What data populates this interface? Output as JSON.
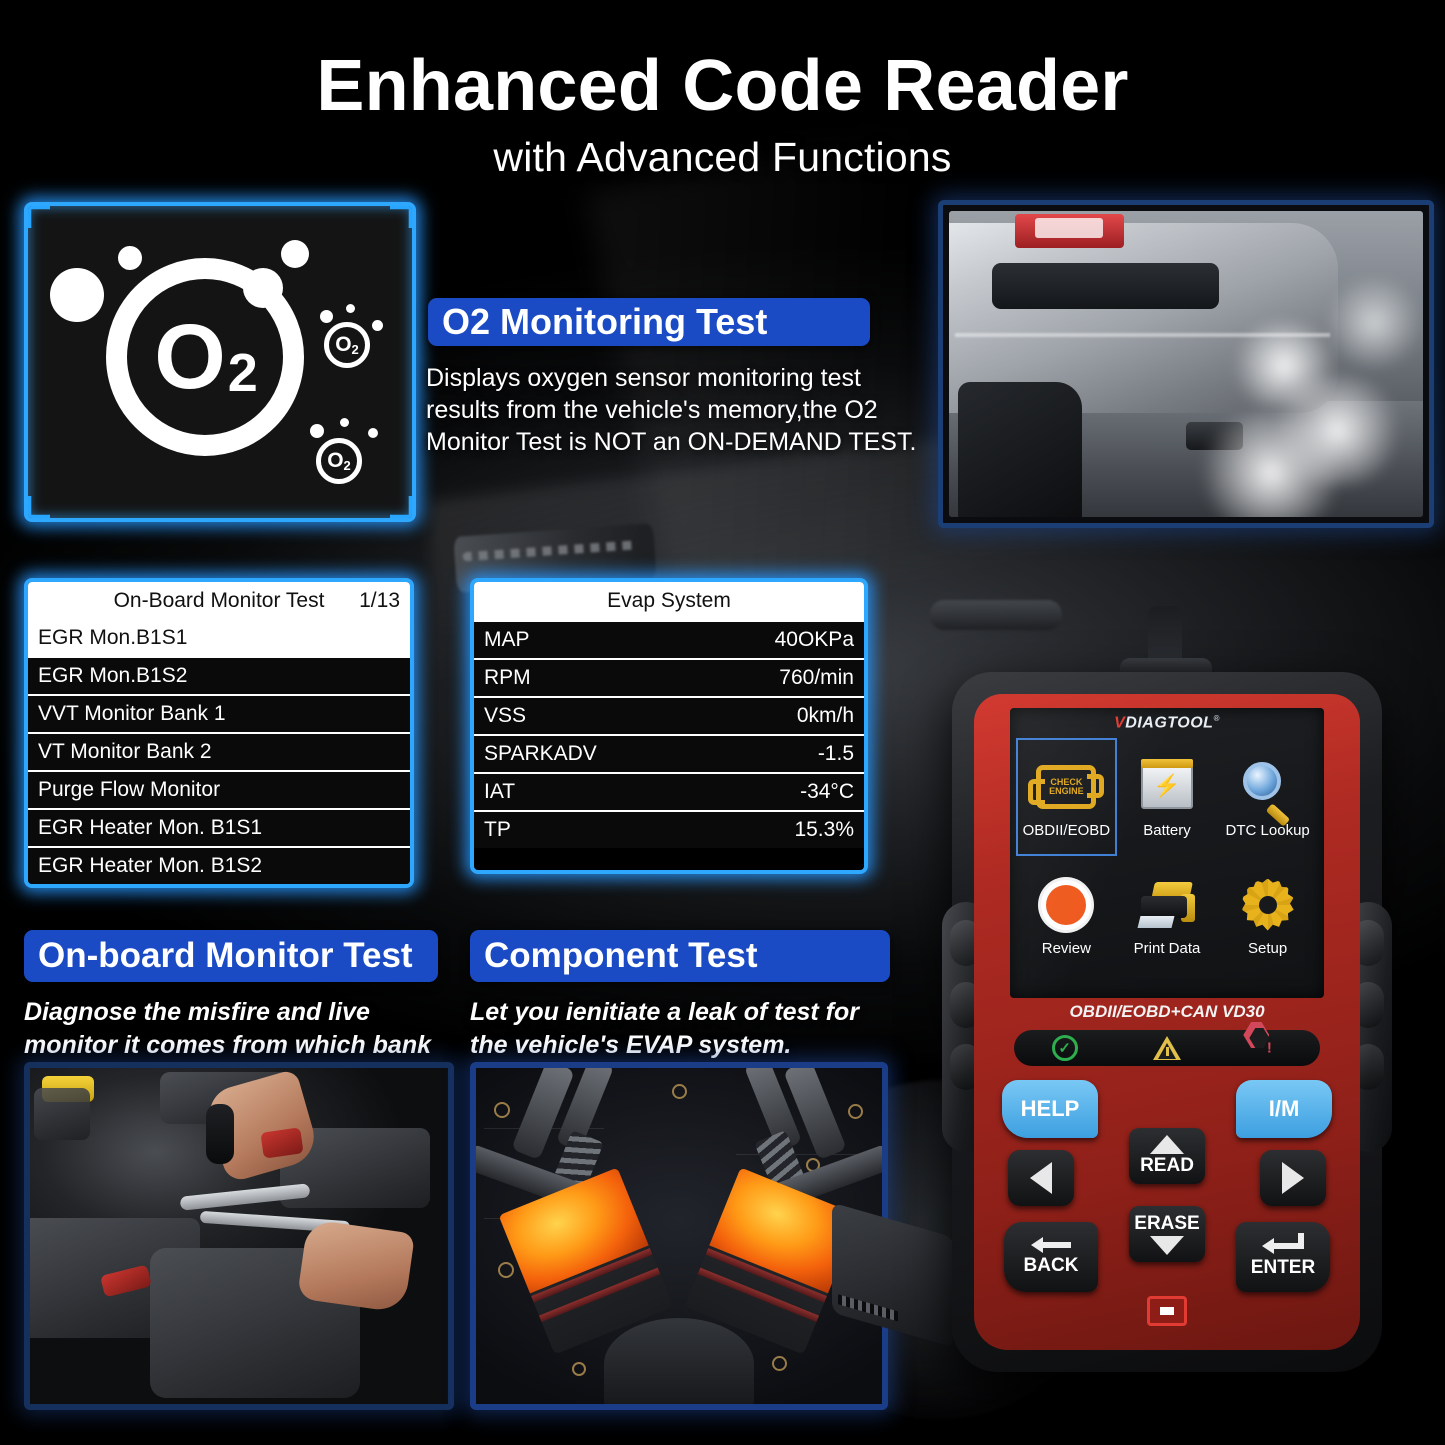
{
  "header": {
    "title": "Enhanced Code Reader",
    "subtitle": "with Advanced Functions"
  },
  "features": {
    "o2": {
      "heading": "O2 Monitoring Test",
      "description": "Displays oxygen sensor monitoring test results from the vehicle's memory,the O2 Monitor Test is NOT an  ON-DEMAND TEST.",
      "logo_text": "O",
      "logo_sub": "2",
      "badge_text": "O",
      "badge_sub": "2"
    },
    "onboard": {
      "heading": "On-board Monitor Test",
      "description": "Diagnose the misfire and live monitor it comes from which bank and cylinder."
    },
    "component": {
      "heading": "Component Test",
      "description": "Let you ienitiate a leak of test for the vehicle's EVAP system."
    }
  },
  "screens": {
    "onboard_monitor": {
      "title": "On-Board Monitor Test",
      "page": "1/13",
      "rows": [
        {
          "label": "EGR Mon.B1S1",
          "selected": true
        },
        {
          "label": "EGR Mon.B1S2",
          "selected": false
        },
        {
          "label": "VVT Monitor Bank 1",
          "selected": false
        },
        {
          "label": "VT Monitor Bank 2",
          "selected": false
        },
        {
          "label": "Purge Flow Monitor",
          "selected": false
        },
        {
          "label": "EGR Heater Mon. B1S1",
          "selected": false
        },
        {
          "label": "EGR Heater Mon. B1S2",
          "selected": false
        }
      ]
    },
    "evap_system": {
      "title": "Evap System",
      "rows": [
        {
          "label": "MAP",
          "value": "40OKPa"
        },
        {
          "label": "RPM",
          "value": "760/min"
        },
        {
          "label": "VSS",
          "value": "0km/h"
        },
        {
          "label": "SPARKADV",
          "value": "-1.5"
        },
        {
          "label": "IAT",
          "value": "-34°C"
        },
        {
          "label": "TP",
          "value": "15.3%"
        }
      ]
    }
  },
  "device": {
    "brand_v": "V",
    "brand_name": "DIAGTOOL",
    "brand_reg": "®",
    "model": "OBDII/EOBD+CAN VD30",
    "menu": [
      {
        "label": "OBDII/EOBD",
        "icon": "check-engine-icon",
        "selected": true
      },
      {
        "label": "Battery",
        "icon": "battery-icon",
        "selected": false
      },
      {
        "label": "DTC Lookup",
        "icon": "magnifier-icon",
        "selected": false
      },
      {
        "label": "Review",
        "icon": "play-circle-icon",
        "selected": false
      },
      {
        "label": "Print Data",
        "icon": "printer-icon",
        "selected": false
      },
      {
        "label": "Setup",
        "icon": "gear-icon",
        "selected": false
      }
    ],
    "check_engine_text": "CHECK ENGINE",
    "leds": [
      {
        "name": "status-ok-led",
        "icon": "check-circle-icon",
        "color": "#2eae4e"
      },
      {
        "name": "status-warning-led",
        "icon": "warning-triangle-icon",
        "color": "#e0c04a"
      },
      {
        "name": "status-error-led",
        "icon": "stop-hexagon-icon",
        "color": "#d2485a"
      }
    ],
    "keys": {
      "help": "HELP",
      "im": "I/M",
      "read": "READ",
      "erase": "ERASE",
      "back": "BACK",
      "enter": "ENTER",
      "left": "",
      "right": ""
    }
  },
  "colors": {
    "accent_blue": "#1b4bc4",
    "glow_cyan": "#2ea8ff",
    "device_red": "#ae2a22",
    "key_blue": "#3d9fe0",
    "icon_gold": "#e0a81e"
  }
}
